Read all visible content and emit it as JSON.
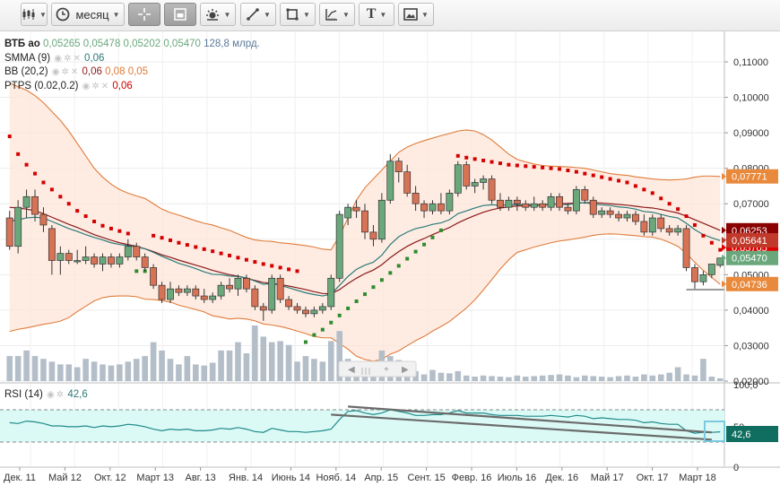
{
  "toolbar": {
    "period": "месяц",
    "buttons": [
      {
        "name": "chart-type-button",
        "icon": "candlestick-icon",
        "caret": true
      },
      {
        "name": "period-button",
        "icon": "clock-icon",
        "caret": true
      },
      {
        "name": "crosshair-button",
        "icon": "crosshair-icon",
        "caret": false,
        "active": true
      },
      {
        "name": "indicator-panel-button",
        "icon": "panel-icon",
        "caret": false,
        "active": true
      },
      {
        "name": "indicators-button",
        "icon": "gear-sun-icon",
        "caret": true
      },
      {
        "name": "draw-line-button",
        "icon": "line-tool-icon",
        "caret": true
      },
      {
        "name": "shapes-button",
        "icon": "rectangle-tool-icon",
        "caret": true
      },
      {
        "name": "fibonacci-button",
        "icon": "fibonacci-icon",
        "caret": true
      },
      {
        "name": "text-button",
        "icon": "text-tool-icon",
        "caret": true
      },
      {
        "name": "snapshot-button",
        "icon": "image-icon",
        "caret": true
      }
    ]
  },
  "legend": {
    "symbol": "ВТБ ао",
    "open": "0,05265",
    "high": "0,05478",
    "low": "0,05202",
    "close": "0,05470",
    "volume": "128,8 млрд.",
    "smma": {
      "label": "SMMA (9)",
      "value": "0,06",
      "color": "#2b7a78"
    },
    "bb": {
      "label": "BB (20,2)",
      "values": [
        "0,06",
        "0,08",
        "0,05"
      ],
      "colors": [
        "#8b1a1a",
        "#e07b39",
        "#e07b39"
      ]
    },
    "ptps": {
      "label": "PTPS (0.02,0.2)",
      "value": "0,06",
      "color": "#cc0000"
    }
  },
  "rsi_legend": {
    "label": "RSI (14)",
    "value": "42,6"
  },
  "price_labels": [
    {
      "value": "0,07771",
      "color": "#e8893c"
    },
    {
      "value": "0,06253",
      "color": "#8b0000"
    },
    {
      "value": "0,05705",
      "color": "#e00000"
    },
    {
      "value": "0,05641",
      "color": "#c0392b"
    },
    {
      "value": "0,05470",
      "color": "#6aa87c"
    },
    {
      "value": "0,04736",
      "color": "#e8893c"
    }
  ],
  "rsi_label": {
    "value": "42,6",
    "color": "#0f6e5f"
  },
  "colors": {
    "up": "#6aa87c",
    "down": "#d77254",
    "smma": "#2b7a78",
    "bb_mid": "#8b1a1a",
    "bb_band": "#e07b39",
    "bb_fill": "#fde6d9",
    "ptps_down": "#d40000",
    "ptps_up": "#2e8b2e",
    "volume": "#b4bec9",
    "rsi": "#1e8a8a",
    "rsi_fill": "#dcfaf5"
  },
  "chart_data": {
    "type": "candlestick",
    "title": "ВТБ ао",
    "x_ticks": [
      "Дек. 11",
      "Май 12",
      "Окт. 12",
      "Март 13",
      "Авг. 13",
      "Янв. 14",
      "Июнь 14",
      "Нояб. 14",
      "Апр. 15",
      "Сент. 15",
      "Февр. 16",
      "Июль 16",
      "Дек. 16",
      "Май 17",
      "Окт. 17",
      "Март 18"
    ],
    "y_ticks": [
      "0,11000",
      "0,10000",
      "0,09000",
      "0,08000",
      "0,07000",
      "0,06000",
      "0,05000",
      "0,04000",
      "0,03000",
      "0,02000"
    ],
    "ylim": [
      0.02,
      0.11
    ],
    "rsi_ticks": [
      "100,0",
      "50",
      "0"
    ],
    "rsi_ylim": [
      0,
      100
    ],
    "rsi_levels": [
      70,
      30
    ],
    "candles": [
      [
        0.066,
        0.068,
        0.057,
        0.058
      ],
      [
        0.058,
        0.071,
        0.056,
        0.069
      ],
      [
        0.069,
        0.074,
        0.066,
        0.072
      ],
      [
        0.072,
        0.074,
        0.065,
        0.067
      ],
      [
        0.067,
        0.069,
        0.062,
        0.064
      ],
      [
        0.063,
        0.064,
        0.05,
        0.054
      ],
      [
        0.054,
        0.058,
        0.05,
        0.056
      ],
      [
        0.056,
        0.057,
        0.053,
        0.054
      ],
      [
        0.054,
        0.057,
        0.053,
        0.054
      ],
      [
        0.054,
        0.058,
        0.053,
        0.055
      ],
      [
        0.055,
        0.056,
        0.052,
        0.053
      ],
      [
        0.053,
        0.056,
        0.051,
        0.055
      ],
      [
        0.055,
        0.056,
        0.052,
        0.053
      ],
      [
        0.053,
        0.056,
        0.052,
        0.055
      ],
      [
        0.055,
        0.06,
        0.054,
        0.058
      ],
      [
        0.058,
        0.059,
        0.054,
        0.055
      ],
      [
        0.055,
        0.056,
        0.051,
        0.052
      ],
      [
        0.052,
        0.053,
        0.046,
        0.047
      ],
      [
        0.047,
        0.048,
        0.042,
        0.043
      ],
      [
        0.043,
        0.048,
        0.042,
        0.046
      ],
      [
        0.046,
        0.047,
        0.044,
        0.045
      ],
      [
        0.045,
        0.047,
        0.044,
        0.046
      ],
      [
        0.046,
        0.047,
        0.043,
        0.044
      ],
      [
        0.044,
        0.046,
        0.042,
        0.043
      ],
      [
        0.043,
        0.045,
        0.042,
        0.044
      ],
      [
        0.044,
        0.048,
        0.043,
        0.047
      ],
      [
        0.047,
        0.049,
        0.045,
        0.046
      ],
      [
        0.046,
        0.05,
        0.044,
        0.049
      ],
      [
        0.049,
        0.05,
        0.045,
        0.046
      ],
      [
        0.046,
        0.047,
        0.04,
        0.041
      ],
      [
        0.041,
        0.042,
        0.037,
        0.04
      ],
      [
        0.04,
        0.05,
        0.039,
        0.049
      ],
      [
        0.049,
        0.05,
        0.042,
        0.043
      ],
      [
        0.043,
        0.044,
        0.04,
        0.041
      ],
      [
        0.041,
        0.042,
        0.039,
        0.04
      ],
      [
        0.04,
        0.041,
        0.038,
        0.039
      ],
      [
        0.039,
        0.041,
        0.038,
        0.04
      ],
      [
        0.04,
        0.042,
        0.039,
        0.041
      ],
      [
        0.041,
        0.05,
        0.04,
        0.049
      ],
      [
        0.049,
        0.068,
        0.048,
        0.067
      ],
      [
        0.066,
        0.07,
        0.064,
        0.069
      ],
      [
        0.069,
        0.071,
        0.066,
        0.068
      ],
      [
        0.068,
        0.07,
        0.06,
        0.062
      ],
      [
        0.062,
        0.064,
        0.058,
        0.06
      ],
      [
        0.06,
        0.073,
        0.059,
        0.071
      ],
      [
        0.071,
        0.084,
        0.07,
        0.082
      ],
      [
        0.082,
        0.083,
        0.076,
        0.079
      ],
      [
        0.079,
        0.081,
        0.072,
        0.073
      ],
      [
        0.073,
        0.075,
        0.068,
        0.07
      ],
      [
        0.07,
        0.071,
        0.066,
        0.068
      ],
      [
        0.068,
        0.071,
        0.067,
        0.07
      ],
      [
        0.07,
        0.073,
        0.067,
        0.068
      ],
      [
        0.068,
        0.074,
        0.067,
        0.073
      ],
      [
        0.073,
        0.082,
        0.072,
        0.081
      ],
      [
        0.081,
        0.082,
        0.074,
        0.075
      ],
      [
        0.075,
        0.077,
        0.073,
        0.076
      ],
      [
        0.076,
        0.078,
        0.074,
        0.077
      ],
      [
        0.077,
        0.078,
        0.07,
        0.071
      ],
      [
        0.071,
        0.073,
        0.068,
        0.069
      ],
      [
        0.069,
        0.072,
        0.068,
        0.071
      ],
      [
        0.071,
        0.072,
        0.068,
        0.07
      ],
      [
        0.07,
        0.071,
        0.068,
        0.069
      ],
      [
        0.069,
        0.072,
        0.068,
        0.07
      ],
      [
        0.07,
        0.071,
        0.068,
        0.069
      ],
      [
        0.069,
        0.073,
        0.068,
        0.072
      ],
      [
        0.072,
        0.073,
        0.068,
        0.069
      ],
      [
        0.069,
        0.07,
        0.067,
        0.068
      ],
      [
        0.068,
        0.075,
        0.067,
        0.074
      ],
      [
        0.074,
        0.075,
        0.07,
        0.071
      ],
      [
        0.071,
        0.072,
        0.066,
        0.067
      ],
      [
        0.067,
        0.069,
        0.066,
        0.068
      ],
      [
        0.068,
        0.069,
        0.066,
        0.067
      ],
      [
        0.067,
        0.068,
        0.065,
        0.066
      ],
      [
        0.066,
        0.068,
        0.065,
        0.067
      ],
      [
        0.067,
        0.068,
        0.064,
        0.065
      ],
      [
        0.065,
        0.067,
        0.061,
        0.062
      ],
      [
        0.062,
        0.067,
        0.061,
        0.066
      ],
      [
        0.066,
        0.067,
        0.062,
        0.063
      ],
      [
        0.063,
        0.064,
        0.061,
        0.062
      ],
      [
        0.062,
        0.064,
        0.061,
        0.063
      ],
      [
        0.063,
        0.064,
        0.051,
        0.052
      ],
      [
        0.052,
        0.053,
        0.046,
        0.048
      ],
      [
        0.048,
        0.051,
        0.047,
        0.05
      ],
      [
        0.05,
        0.053,
        0.049,
        0.053
      ],
      [
        0.05265,
        0.05478,
        0.05202,
        0.0547
      ]
    ],
    "smma_9": [
      0.065,
      0.0655,
      0.066,
      0.0662,
      0.066,
      0.065,
      0.064,
      0.063,
      0.0622,
      0.0613,
      0.0605,
      0.0598,
      0.059,
      0.0585,
      0.0582,
      0.0578,
      0.0573,
      0.0563,
      0.0552,
      0.0542,
      0.0532,
      0.0525,
      0.0517,
      0.0508,
      0.0501,
      0.05,
      0.0496,
      0.0495,
      0.0491,
      0.0482,
      0.0473,
      0.0475,
      0.047,
      0.0463,
      0.0456,
      0.0449,
      0.0444,
      0.044,
      0.0445,
      0.047,
      0.0495,
      0.0515,
      0.0527,
      0.0535,
      0.0555,
      0.0585,
      0.0607,
      0.062,
      0.063,
      0.0635,
      0.0642,
      0.0646,
      0.0655,
      0.0672,
      0.068,
      0.0688,
      0.0695,
      0.0697,
      0.0696,
      0.0697,
      0.0698,
      0.0697,
      0.0698,
      0.0697,
      0.07,
      0.0699,
      0.0697,
      0.0702,
      0.0703,
      0.0699,
      0.0697,
      0.0695,
      0.0691,
      0.0689,
      0.0685,
      0.0678,
      0.0676,
      0.067,
      0.0664,
      0.066,
      0.0645,
      0.0627,
      0.0613,
      0.0604,
      0.0596
    ],
    "bb_middle": [
      0.069,
      0.0688,
      0.0685,
      0.068,
      0.0672,
      0.0662,
      0.0652,
      0.0642,
      0.0633,
      0.0623,
      0.0613,
      0.0605,
      0.0597,
      0.059,
      0.0585,
      0.058,
      0.0573,
      0.0565,
      0.0556,
      0.0549,
      0.0541,
      0.0534,
      0.0527,
      0.052,
      0.0512,
      0.0506,
      0.05,
      0.0496,
      0.049,
      0.0484,
      0.0478,
      0.0476,
      0.0472,
      0.0468,
      0.0463,
      0.0458,
      0.0452,
      0.0447,
      0.0446,
      0.0458,
      0.0475,
      0.049,
      0.0503,
      0.0513,
      0.0528,
      0.0548,
      0.0565,
      0.058,
      0.0592,
      0.0602,
      0.0613,
      0.0623,
      0.0633,
      0.0646,
      0.0657,
      0.0667,
      0.0676,
      0.0683,
      0.0688,
      0.0691,
      0.0694,
      0.0694,
      0.0695,
      0.0696,
      0.0698,
      0.07,
      0.0701,
      0.0702,
      0.0703,
      0.0703,
      0.0702,
      0.07,
      0.0698,
      0.0696,
      0.0693,
      0.069,
      0.0688,
      0.0684,
      0.0679,
      0.0674,
      0.0665,
      0.0655,
      0.0645,
      0.0635,
      0.0625
    ],
    "bb_upper": [
      0.104,
      0.103,
      0.102,
      0.1005,
      0.0985,
      0.096,
      0.0935,
      0.0905,
      0.087,
      0.0835,
      0.08,
      0.0775,
      0.0755,
      0.074,
      0.073,
      0.0722,
      0.0715,
      0.07,
      0.0685,
      0.0675,
      0.0668,
      0.066,
      0.0652,
      0.0645,
      0.064,
      0.0632,
      0.0625,
      0.0615,
      0.0605,
      0.0598,
      0.0595,
      0.0594,
      0.059,
      0.0588,
      0.0585,
      0.0582,
      0.0578,
      0.0572,
      0.057,
      0.061,
      0.066,
      0.071,
      0.0745,
      0.077,
      0.0795,
      0.082,
      0.0845,
      0.086,
      0.087,
      0.0878,
      0.0885,
      0.0892,
      0.0898,
      0.0905,
      0.0908,
      0.0905,
      0.0895,
      0.088,
      0.086,
      0.084,
      0.0825,
      0.0818,
      0.0812,
      0.0808,
      0.0806,
      0.0805,
      0.0804,
      0.0802,
      0.08,
      0.0795,
      0.079,
      0.0785,
      0.0782,
      0.078,
      0.0776,
      0.0773,
      0.077,
      0.0768,
      0.0767,
      0.0768,
      0.077,
      0.0775,
      0.0778,
      0.0778,
      0.0777
    ],
    "bb_lower": [
      0.034,
      0.0346,
      0.035,
      0.0355,
      0.036,
      0.0364,
      0.0369,
      0.0379,
      0.0396,
      0.0411,
      0.0426,
      0.0435,
      0.0439,
      0.044,
      0.044,
      0.0438,
      0.0431,
      0.043,
      0.0427,
      0.0423,
      0.0414,
      0.0408,
      0.0402,
      0.0395,
      0.0384,
      0.038,
      0.0375,
      0.0377,
      0.0375,
      0.037,
      0.0361,
      0.0358,
      0.0354,
      0.0348,
      0.0341,
      0.0334,
      0.0326,
      0.0322,
      0.0322,
      0.0306,
      0.029,
      0.027,
      0.0261,
      0.0256,
      0.0261,
      0.0276,
      0.0285,
      0.03,
      0.0314,
      0.0326,
      0.0341,
      0.0354,
      0.0368,
      0.0387,
      0.0406,
      0.0429,
      0.0457,
      0.0486,
      0.0516,
      0.0542,
      0.0563,
      0.057,
      0.0578,
      0.0584,
      0.059,
      0.0595,
      0.0598,
      0.0602,
      0.0606,
      0.0611,
      0.0614,
      0.0615,
      0.0614,
      0.0612,
      0.061,
      0.0607,
      0.0606,
      0.06,
      0.0591,
      0.058,
      0.056,
      0.0535,
      0.0512,
      0.0492,
      0.0473
    ],
    "ptps": [
      0.089,
      0.084,
      0.081,
      0.0785,
      0.076,
      0.074,
      0.072,
      0.07,
      0.068,
      0.0665,
      0.065,
      0.0638,
      0.063,
      0.0623,
      0.0616,
      0.051,
      0.051,
      0.061,
      0.0604,
      0.0597,
      0.059,
      0.0584,
      0.0578,
      0.0572,
      0.0566,
      0.056,
      0.0554,
      0.0548,
      0.0542,
      0.0536,
      0.053,
      0.0525,
      0.052,
      0.0515,
      0.051,
      0.031,
      0.033,
      0.0345,
      0.0365,
      0.0385,
      0.0405,
      0.0425,
      0.0445,
      0.0465,
      0.0485,
      0.0505,
      0.0525,
      0.0545,
      0.0565,
      0.0585,
      0.0605,
      0.0625,
      0.069,
      0.0835,
      0.083,
      0.0826,
      0.0822,
      0.0818,
      0.0814,
      0.081,
      0.0808,
      0.0806,
      0.0804,
      0.0802,
      0.08,
      0.0798,
      0.0794,
      0.079,
      0.0785,
      0.078,
      0.0775,
      0.077,
      0.0765,
      0.076,
      0.075,
      0.074,
      0.073,
      0.0715,
      0.07,
      0.0685,
      0.0665,
      0.064,
      0.061,
      0.059,
      0.057
    ],
    "ptps_trend": [
      "down",
      "down",
      "down",
      "down",
      "down",
      "down",
      "down",
      "down",
      "down",
      "down",
      "down",
      "down",
      "down",
      "down",
      "down",
      "up",
      "up",
      "down",
      "down",
      "down",
      "down",
      "down",
      "down",
      "down",
      "down",
      "down",
      "down",
      "down",
      "down",
      "down",
      "down",
      "down",
      "down",
      "down",
      "down",
      "up",
      "up",
      "up",
      "up",
      "up",
      "up",
      "up",
      "up",
      "up",
      "up",
      "up",
      "up",
      "up",
      "up",
      "up",
      "up",
      "up",
      "up",
      "down",
      "down",
      "down",
      "down",
      "down",
      "down",
      "down",
      "down",
      "down",
      "down",
      "down",
      "down",
      "down",
      "down",
      "down",
      "down",
      "down",
      "down",
      "down",
      "down",
      "down",
      "down",
      "down",
      "down",
      "down",
      "down",
      "down",
      "down",
      "down",
      "down",
      "down",
      "down"
    ],
    "volume_rel": [
      0.45,
      0.45,
      0.55,
      0.45,
      0.4,
      0.35,
      0.3,
      0.3,
      0.25,
      0.4,
      0.35,
      0.3,
      0.28,
      0.3,
      0.35,
      0.4,
      0.45,
      0.7,
      0.55,
      0.4,
      0.3,
      0.45,
      0.3,
      0.28,
      0.33,
      0.55,
      0.55,
      0.7,
      0.5,
      1.0,
      0.8,
      0.7,
      0.72,
      0.65,
      0.35,
      0.45,
      0.4,
      0.35,
      0.72,
      0.9,
      0.4,
      0.35,
      0.3,
      0.28,
      0.55,
      0.45,
      0.38,
      0.25,
      0.18,
      0.12,
      0.2,
      0.15,
      0.14,
      0.18,
      0.1,
      0.08,
      0.1,
      0.09,
      0.08,
      0.07,
      0.1,
      0.08,
      0.09,
      0.1,
      0.11,
      0.12,
      0.1,
      0.07,
      0.1,
      0.09,
      0.08,
      0.07,
      0.09,
      0.1,
      0.08,
      0.12,
      0.1,
      0.12,
      0.15,
      0.25,
      0.12,
      0.1,
      0.4,
      0.08,
      0.05
    ],
    "rsi": [
      54,
      53,
      56,
      55,
      53,
      50,
      50,
      49,
      49,
      50,
      48,
      50,
      49,
      50,
      52,
      51,
      49,
      46,
      44,
      46,
      45,
      46,
      44,
      44,
      45,
      47,
      46,
      48,
      46,
      43,
      42,
      47,
      45,
      43,
      43,
      42,
      43,
      44,
      46,
      58,
      68,
      69,
      66,
      64,
      66,
      70,
      68,
      66,
      63,
      63,
      64,
      64,
      66,
      69,
      66,
      66,
      66,
      64,
      63,
      63,
      63,
      62,
      62,
      62,
      63,
      62,
      61,
      63,
      62,
      59,
      60,
      59,
      58,
      58,
      57,
      54,
      55,
      53,
      52,
      52,
      44,
      41,
      42,
      42,
      42.6
    ],
    "rsi_trendlines": [
      {
        "from": [
          40,
          74
        ],
        "to": [
          83,
          42
        ]
      },
      {
        "from": [
          38,
          64
        ],
        "to": [
          83,
          33
        ]
      }
    ],
    "support_line": {
      "from": [
        80,
        0.0458
      ],
      "to": [
        86,
        0.0458
      ]
    }
  }
}
